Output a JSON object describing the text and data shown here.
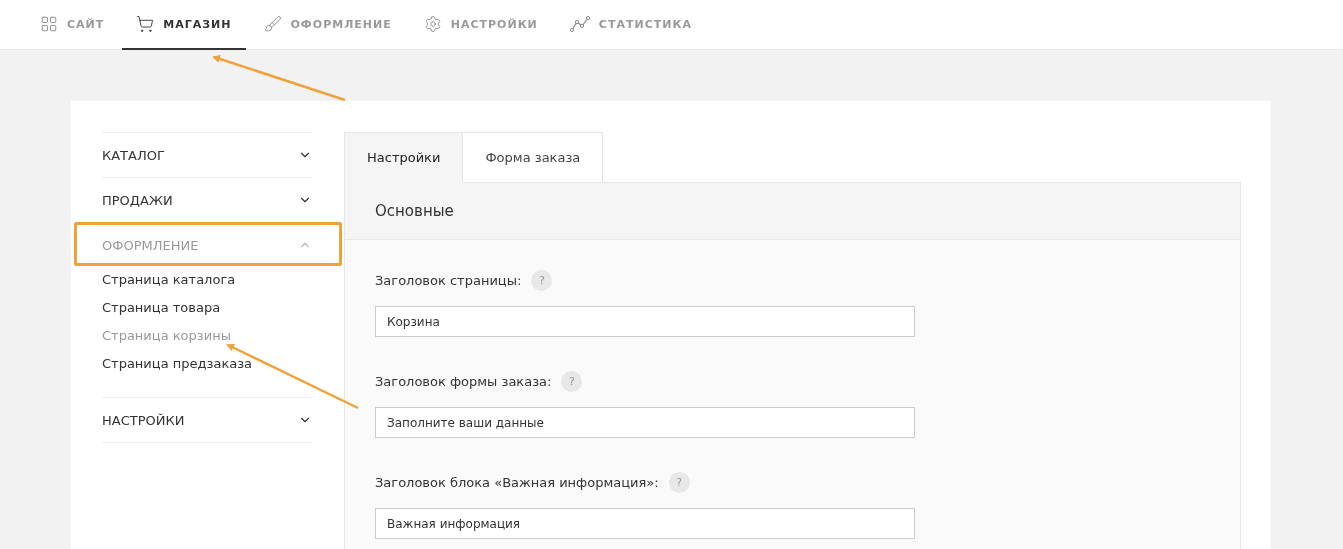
{
  "top_nav": [
    {
      "label": "САЙТ",
      "selected": false
    },
    {
      "label": "МАГАЗИН",
      "selected": true
    },
    {
      "label": "ОФОРМЛЕНИЕ",
      "selected": false
    },
    {
      "label": "НАСТРОЙКИ",
      "selected": false
    },
    {
      "label": "СТАТИСТИКА",
      "selected": false
    }
  ],
  "sidebar": [
    {
      "label": "КАТАЛОГ",
      "expanded": false,
      "highlighted": false
    },
    {
      "label": "ПРОДАЖИ",
      "expanded": false,
      "highlighted": false
    },
    {
      "label": "ОФОРМЛЕНИЕ",
      "expanded": true,
      "highlighted": true,
      "children": [
        {
          "label": "Страница каталога",
          "selected": false
        },
        {
          "label": "Страница товара",
          "selected": false
        },
        {
          "label": "Страница корзины",
          "selected": true
        },
        {
          "label": "Страница предзаказа",
          "selected": false
        }
      ]
    },
    {
      "label": "НАСТРОЙКИ",
      "expanded": false,
      "highlighted": false
    }
  ],
  "tabs": [
    {
      "label": "Настройки",
      "selected": true
    },
    {
      "label": "Форма заказа",
      "selected": false
    }
  ],
  "section_title": "Основные",
  "fields": [
    {
      "label": "Заголовок страницы:",
      "help": "?",
      "value": "Корзина"
    },
    {
      "label": "Заголовок формы заказа:",
      "help": "?",
      "value": "Заполните ваши данные"
    },
    {
      "label": "Заголовок блока «Важная информация»:",
      "help": "?",
      "value": "Важная информация"
    }
  ]
}
